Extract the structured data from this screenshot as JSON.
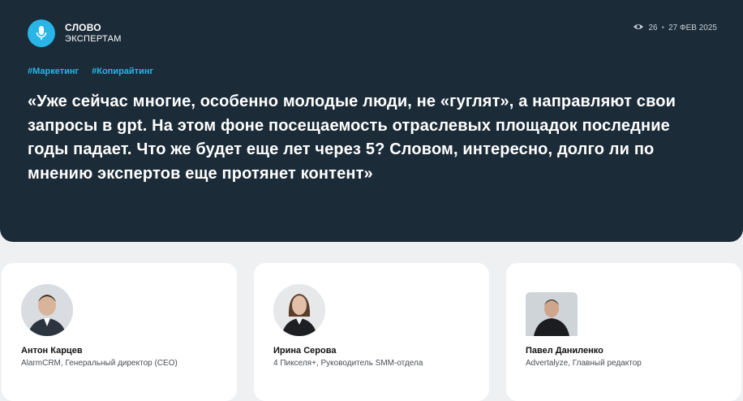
{
  "header": {
    "brand_line1": "СЛОВО",
    "brand_line2": "ЭКСПЕРТАМ",
    "views": "26",
    "date": "27 ФЕВ 2025",
    "accent_color": "#29b5e8",
    "background_color": "#1b2b38"
  },
  "tags": [
    "#Маркетинг",
    "#Копирайтинг"
  ],
  "quote": "«Уже сейчас многие, особенно молодые люди, не «гуглят», а направляют свои запросы в gpt. На этом фоне посещаемость отраслевых площадок последние годы падает. Что же будет еще лет через 5? Словом, интересно, долго ли по мнению экспертов еще протянет контент»",
  "experts": [
    {
      "name": "Антон Карцев",
      "role": "AlarmCRM, Генеральный директор (CEO)"
    },
    {
      "name": "Ирина Серова",
      "role": "4 Пикселя+, Руководитель SMM-отдела"
    },
    {
      "name": "Павел Даниленко",
      "role": "Advertalyze, Главный редактор"
    }
  ],
  "icons": {
    "brand": "microphone-icon",
    "views": "eye-icon"
  }
}
